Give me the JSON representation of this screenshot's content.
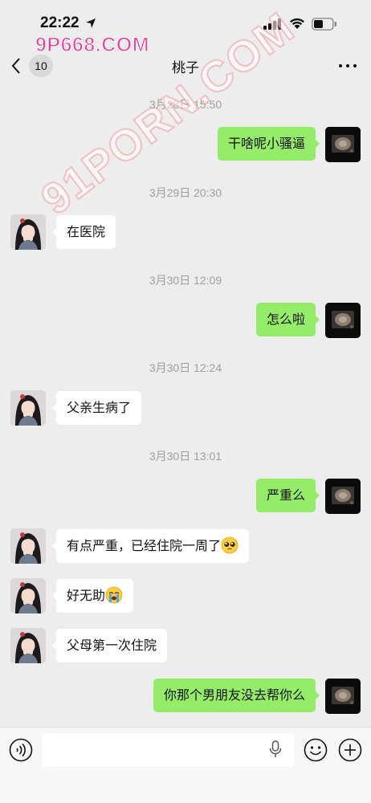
{
  "status_bar": {
    "time": "22:22"
  },
  "watermark": {
    "top": "9P668.COM",
    "diagonal": "91PORN.COM"
  },
  "header": {
    "unread_count": "10",
    "title": "桃子"
  },
  "messages": [
    {
      "type": "timestamp",
      "text": "3月28日 15:50"
    },
    {
      "type": "message",
      "side": "out",
      "text": "干啥呢小骚逼"
    },
    {
      "type": "timestamp",
      "text": "3月29日 20:30"
    },
    {
      "type": "message",
      "side": "in",
      "text": "在医院"
    },
    {
      "type": "timestamp",
      "text": "3月30日 12:09"
    },
    {
      "type": "message",
      "side": "out",
      "text": "怎么啦"
    },
    {
      "type": "timestamp",
      "text": "3月30日 12:24"
    },
    {
      "type": "message",
      "side": "in",
      "text": "父亲生病了"
    },
    {
      "type": "timestamp",
      "text": "3月30日 13:01"
    },
    {
      "type": "message",
      "side": "out",
      "text": "严重么"
    },
    {
      "type": "message",
      "side": "in",
      "text": "有点严重，已经住院一周了",
      "emoji": "pleading-face-emoji"
    },
    {
      "type": "message",
      "side": "in",
      "text": "好无助",
      "emoji": "crying-face-emoji"
    },
    {
      "type": "message",
      "side": "in",
      "text": "父母第一次住院"
    },
    {
      "type": "message",
      "side": "out",
      "text": "你那个男朋友没去帮你么"
    }
  ],
  "input_bar": {
    "value": ""
  },
  "icons": {
    "back": "chevron-left-icon",
    "more": "more-dots-icon",
    "voice": "voice-icon",
    "mic": "microphone-icon",
    "emoji": "emoji-icon",
    "plus": "plus-icon"
  },
  "colors": {
    "background": "#ededed",
    "bubble_out": "#95ec69",
    "bubble_in": "#ffffff",
    "timestamp": "#9e9e9e",
    "watermark": "#e8409a"
  }
}
